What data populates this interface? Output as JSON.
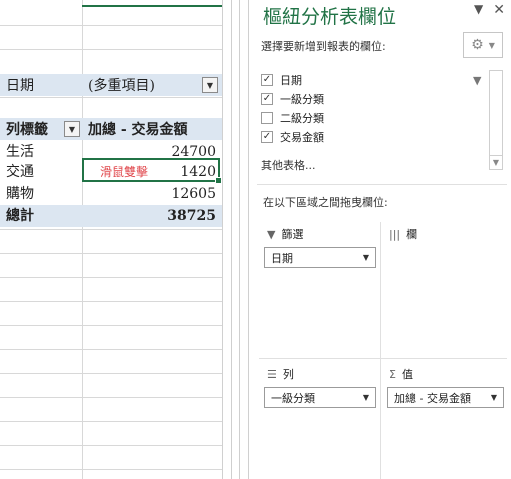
{
  "sheet": {
    "filter_label": "日期",
    "filter_value": "(多重項目)",
    "row_label_header": "列標籤",
    "sum_header": "加總 - 交易金額",
    "rows": [
      {
        "label": "生活",
        "value": "24700"
      },
      {
        "label": "交通",
        "value": "1420"
      },
      {
        "label": "購物",
        "value": "12605"
      }
    ],
    "total": {
      "label": "總計",
      "value": "38725"
    },
    "overlay_text": "滑鼠雙擊",
    "colors": {
      "band": "#dce6f1",
      "selection": "#217346",
      "overlay": "#e0474c"
    }
  },
  "pane": {
    "title": "樞紐分析表欄位",
    "subtitle": "選擇要新增到報表的欄位:",
    "fields": [
      {
        "label": "日期",
        "checked": true
      },
      {
        "label": "一級分類",
        "checked": true
      },
      {
        "label": "二級分類",
        "checked": false
      },
      {
        "label": "交易金額",
        "checked": true
      }
    ],
    "more_tables": "其他表格...",
    "drag_hint": "在以下區域之間拖曳欄位:",
    "areas": {
      "filters": {
        "title": "篩選",
        "item": "日期"
      },
      "columns": {
        "title": "欄"
      },
      "rows": {
        "title": "列",
        "item": "一級分類"
      },
      "values": {
        "title": "值",
        "item": "加總 - 交易金額"
      }
    },
    "icons": [
      "close-icon",
      "chevron-down-icon",
      "gear-icon",
      "filter-icon",
      "columns-icon",
      "rows-icon",
      "sigma-icon"
    ]
  }
}
